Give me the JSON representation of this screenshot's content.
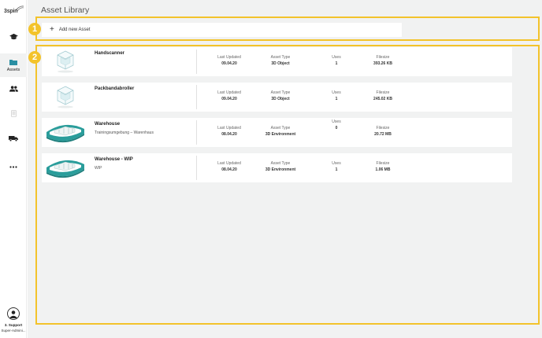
{
  "brand": {
    "logo_text": "3spin"
  },
  "sidebar": {
    "items": [
      {
        "name": "nav-courses",
        "icon": "graduation-cap-icon",
        "label": ""
      },
      {
        "name": "nav-assets",
        "icon": "folder-icon",
        "label": "Assets",
        "active": true
      },
      {
        "name": "nav-users",
        "icon": "users-icon",
        "label": ""
      },
      {
        "name": "nav-devices",
        "icon": "tablet-icon",
        "label": ""
      },
      {
        "name": "nav-vehicles",
        "icon": "truck-icon",
        "label": ""
      },
      {
        "name": "nav-more",
        "icon": "more-icon",
        "label": ""
      }
    ],
    "user": {
      "name": "3. Support",
      "role": "Super-Admini..."
    }
  },
  "page": {
    "title": "Asset Library"
  },
  "add_asset": {
    "label": "Add new Asset"
  },
  "columns": {
    "updated": "Last Updated",
    "type": "Asset Type",
    "uses": "Uses",
    "size": "Filesize"
  },
  "assets": [
    {
      "name": "Handscanner",
      "description": "",
      "updated": "09.04.20",
      "type": "3D Object",
      "uses": "1",
      "size": "393.26 KB",
      "thumb": "cube"
    },
    {
      "name": "Packbandabroller",
      "description": "",
      "updated": "09.04.20",
      "type": "3D Object",
      "uses": "1",
      "size": "245.02 KB",
      "thumb": "cube"
    },
    {
      "name": "Warehouse",
      "description": "Trainingsumgebung – Warenhaus",
      "updated": "08.04.20",
      "type": "3D Environment",
      "uses": "0",
      "size": "20.72 MB",
      "thumb": "environment"
    },
    {
      "name": "Warehouse - WIP",
      "description": "WIP",
      "updated": "08.04.20",
      "type": "3D Environment",
      "uses": "1",
      "size": "1.06 MB",
      "thumb": "environment"
    }
  ],
  "annotations": {
    "badge_1": "1",
    "badge_2": "2"
  },
  "colors": {
    "highlight": "#f3c32b",
    "accent_teal": "#2a9d9b",
    "background": "#f1f2f2"
  }
}
